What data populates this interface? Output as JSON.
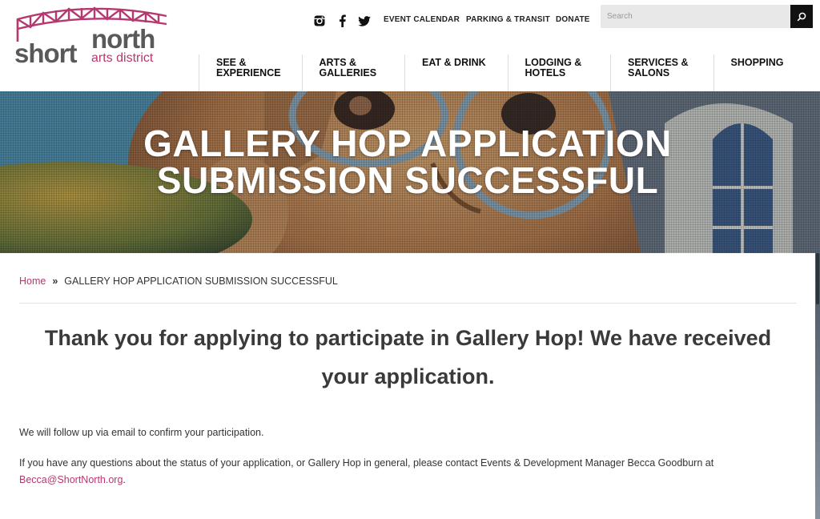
{
  "brand": {
    "logo_short": "short",
    "logo_north": "north",
    "logo_tagline": "arts district",
    "accent_color": "#b5386f",
    "text_color": "#58595b"
  },
  "utility_bar": {
    "social_icons": [
      "instagram-icon",
      "facebook-icon",
      "twitter-icon"
    ],
    "links": [
      "EVENT CALENDAR",
      "PARKING & TRANSIT",
      "DONATE"
    ],
    "search_placeholder": "Search"
  },
  "nav": {
    "items": [
      "SEE &\nEXPERIENCE",
      "ARTS &\nGALLERIES",
      "EAT & DRINK",
      "LODGING &\nHOTELS",
      "SERVICES &\nSALONS",
      "SHOPPING"
    ]
  },
  "hero": {
    "title_line1": "GALLERY HOP APPLICATION",
    "title_line2": "SUBMISSION SUCCESSFUL"
  },
  "breadcrumb": {
    "home": "Home",
    "separator": "»",
    "current": "GALLERY HOP APPLICATION SUBMISSION SUCCESSFUL"
  },
  "content": {
    "heading": "Thank you for applying to participate in Gallery Hop! We have received your application.",
    "paragraph1": "We will follow up via email to confirm your participation.",
    "paragraph2_text": "If you have any questions about the status of your application, or Gallery Hop in general, please contact Events & Development Manager Becca Goodburn at",
    "contact_email": "Becca@ShortNorth.org",
    "paragraph2_end": "."
  }
}
